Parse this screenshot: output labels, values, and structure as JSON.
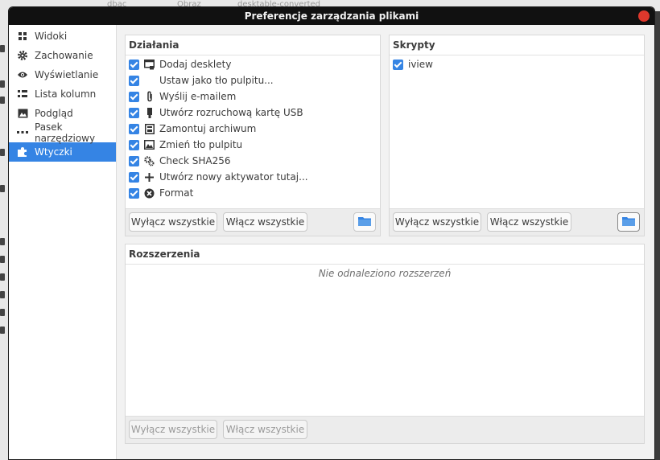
{
  "window": {
    "title": "Preferencje zarządzania plikami"
  },
  "sidebar": {
    "items": [
      {
        "label": "Widoki",
        "icon": "grid-icon"
      },
      {
        "label": "Zachowanie",
        "icon": "gear-icon"
      },
      {
        "label": "Wyświetlanie",
        "icon": "eye-icon"
      },
      {
        "label": "Lista kolumn",
        "icon": "list-icon"
      },
      {
        "label": "Podgląd",
        "icon": "image-icon"
      },
      {
        "label": "Pasek narzędziowy",
        "icon": "dots-icon"
      },
      {
        "label": "Wtyczki",
        "icon": "puzzle-icon",
        "active": true
      }
    ]
  },
  "actions": {
    "title": "Działania",
    "items": [
      {
        "label": "Dodaj desklety",
        "icon": "desklet-icon"
      },
      {
        "label": "Ustaw jako tło pulpitu...",
        "icon": ""
      },
      {
        "label": "Wyślij e-mailem",
        "icon": "paperclip-icon"
      },
      {
        "label": "Utwórz rozruchową kartę USB",
        "icon": "usb-icon"
      },
      {
        "label": "Zamontuj archiwum",
        "icon": "archive-icon"
      },
      {
        "label": "Zmień tło pulpitu",
        "icon": "wallpaper-icon"
      },
      {
        "label": "Check SHA256",
        "icon": "gears-icon"
      },
      {
        "label": "Utwórz nowy aktywator tutaj...",
        "icon": "plus-icon"
      },
      {
        "label": "Format",
        "icon": "format-icon"
      }
    ],
    "disable_all": "Wyłącz wszystkie",
    "enable_all": "Włącz wszystkie"
  },
  "scripts": {
    "title": "Skrypty",
    "items": [
      {
        "label": "iview"
      }
    ],
    "disable_all": "Wyłącz wszystkie",
    "enable_all": "Włącz wszystkie"
  },
  "extensions": {
    "title": "Rozszerzenia",
    "empty_message": "Nie odnaleziono rozszerzeń",
    "disable_all": "Wyłącz wszystkie",
    "enable_all": "Włącz wszystkie"
  },
  "background": {
    "tab1": "dbac",
    "tab2": "Obraz",
    "tab3": "desktable-converted"
  },
  "colors": {
    "accent": "#3584e4",
    "titlebar": "#111111",
    "close": "#df382c"
  }
}
